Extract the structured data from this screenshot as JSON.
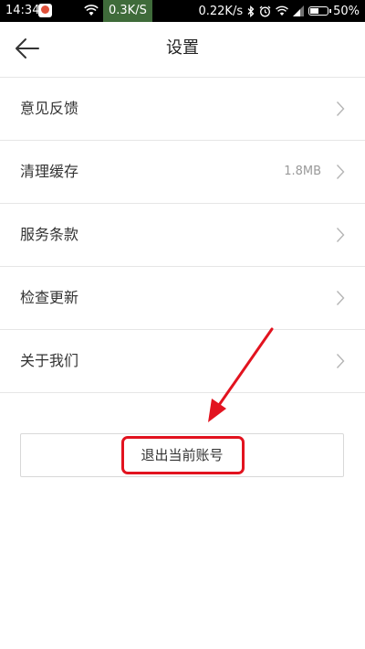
{
  "status_bar": {
    "time": "14:34",
    "network_speed_left": "0.3K/S",
    "network_speed_right": "0.22K/s",
    "battery_percent": "50%",
    "battery_level": 0.5
  },
  "title_bar": {
    "title": "设置"
  },
  "settings": {
    "items": [
      {
        "label": "意见反馈",
        "value": ""
      },
      {
        "label": "清理缓存",
        "value": "1.8MB"
      },
      {
        "label": "服务条款",
        "value": ""
      },
      {
        "label": "检查更新",
        "value": ""
      },
      {
        "label": "关于我们",
        "value": ""
      }
    ]
  },
  "logout": {
    "label": "退出当前账号"
  },
  "colors": {
    "annotation_red": "#e2131f",
    "divider": "#e6e6e6",
    "muted_text": "#9a9a9a"
  }
}
